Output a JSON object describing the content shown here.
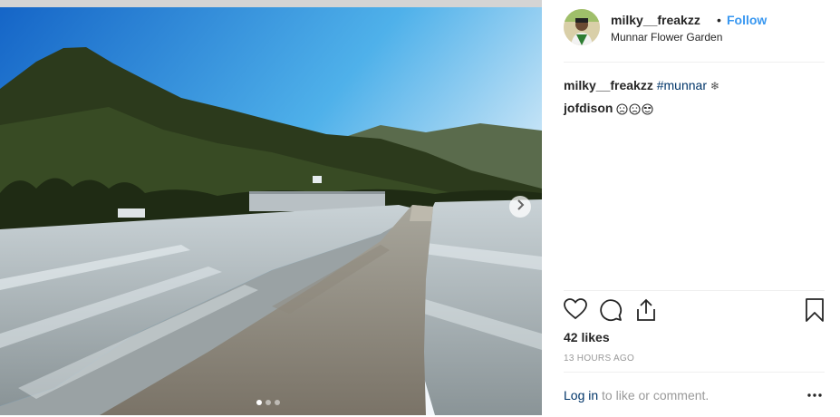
{
  "post": {
    "username": "milky__freakzz",
    "separator": "•",
    "follow_label": "Follow",
    "location": "Munnar Flower Garden",
    "caption_user": "milky__freakzz",
    "caption_hashtag": "#munnar",
    "caption_emoji": "❄",
    "comment_user": "jofdison",
    "likes": "42 likes",
    "timestamp": "13 HOURS AGO",
    "login_link": "Log in",
    "login_text": " to like or comment.",
    "carousel": {
      "total": 3,
      "active": 1
    }
  },
  "icons": {
    "like": "heart-icon",
    "comment": "comment-icon",
    "share": "share-icon",
    "save": "bookmark-icon",
    "more": "more-options-icon",
    "next": "chevron-right-icon"
  },
  "colors": {
    "link_blue": "#3897f0",
    "hashtag": "#003569",
    "muted": "#999999",
    "text": "#262626"
  }
}
